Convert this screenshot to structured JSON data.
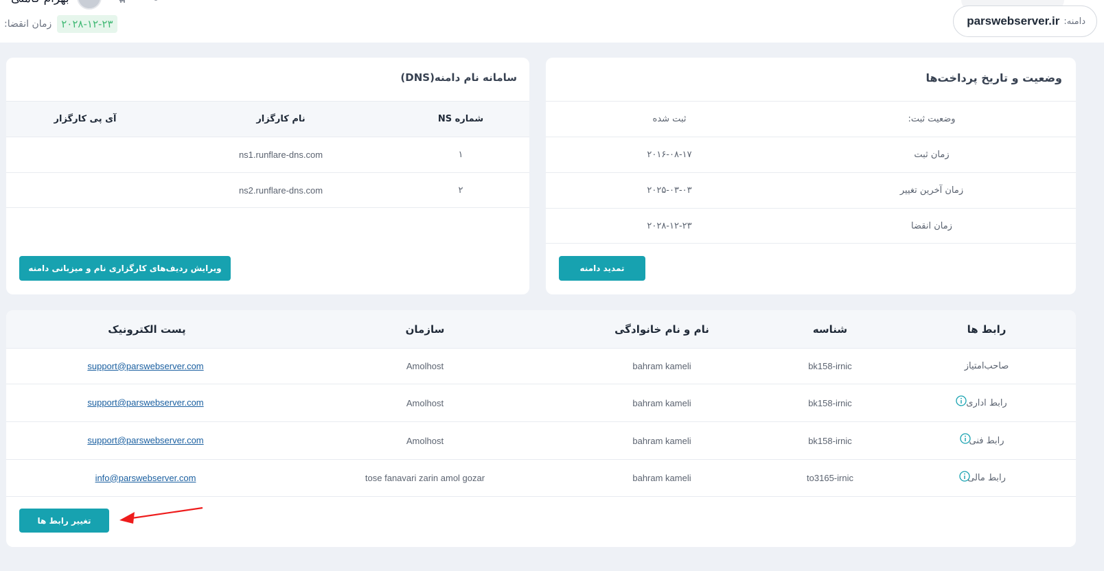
{
  "header": {
    "domain_label": "دامنه:",
    "domain_value": "parswebserver.ir",
    "user_name": "بهرام کاملی",
    "expiry_label": "زمان انقضا:",
    "expiry_value": "۲۰۲۸-۱۲-۲۳"
  },
  "payments": {
    "title": "وضعیت و تاریخ پرداخت‌ها",
    "rows": [
      {
        "label": "وضعیت ثبت:",
        "value": "ثبت شده"
      },
      {
        "label": "زمان ثبت",
        "value": "۲۰۱۶-۰۸-۱۷"
      },
      {
        "label": "زمان آخرین تغییر",
        "value": "۲۰۲۵-۰۳-۰۳"
      },
      {
        "label": "زمان انقضا",
        "value": "۲۰۲۸-۱۲-۲۳"
      }
    ],
    "renew_button": "تمدید دامنه"
  },
  "dns": {
    "title": "سامانه نام دامنه(DNS)",
    "columns": [
      "شماره NS",
      "نام کارگزار",
      "آی پی کارگزار"
    ],
    "rows": [
      {
        "num": "۱",
        "name": "ns1.runflare-dns.com",
        "ip": ""
      },
      {
        "num": "۲",
        "name": "ns2.runflare-dns.com",
        "ip": ""
      }
    ],
    "edit_button": "ویرایش ردیف‌های کارگزاری نام و میزبانی دامنه"
  },
  "contacts": {
    "columns": [
      "رابط ها",
      "شناسه",
      "نام و نام خانوادگی",
      "سازمان",
      "پست الکترونیک"
    ],
    "rows": [
      {
        "role": "صاحب‌امتیاز",
        "id": "bk158-irnic",
        "name": "bahram kameli",
        "org": "Amolhost",
        "email": "support@parswebserver.com",
        "info": false
      },
      {
        "role": "رابط اداری",
        "id": "bk158-irnic",
        "name": "bahram kameli",
        "org": "Amolhost",
        "email": "support@parswebserver.com",
        "info": true
      },
      {
        "role": "رابط فنی",
        "id": "bk158-irnic",
        "name": "bahram kameli",
        "org": "Amolhost",
        "email": "support@parswebserver.com",
        "info": true
      },
      {
        "role": "رابط مالی",
        "id": "to3165-irnic",
        "name": "bahram kameli",
        "org": "tose fanavari zarin amol gozar",
        "email": "info@parswebserver.com",
        "info": true
      }
    ],
    "change_button": "تغییر رابط ها"
  },
  "colors": {
    "accent": "#17a2b0",
    "expiry_badge": "#3fb873",
    "annotation_arrow": "#ee1c1c"
  }
}
